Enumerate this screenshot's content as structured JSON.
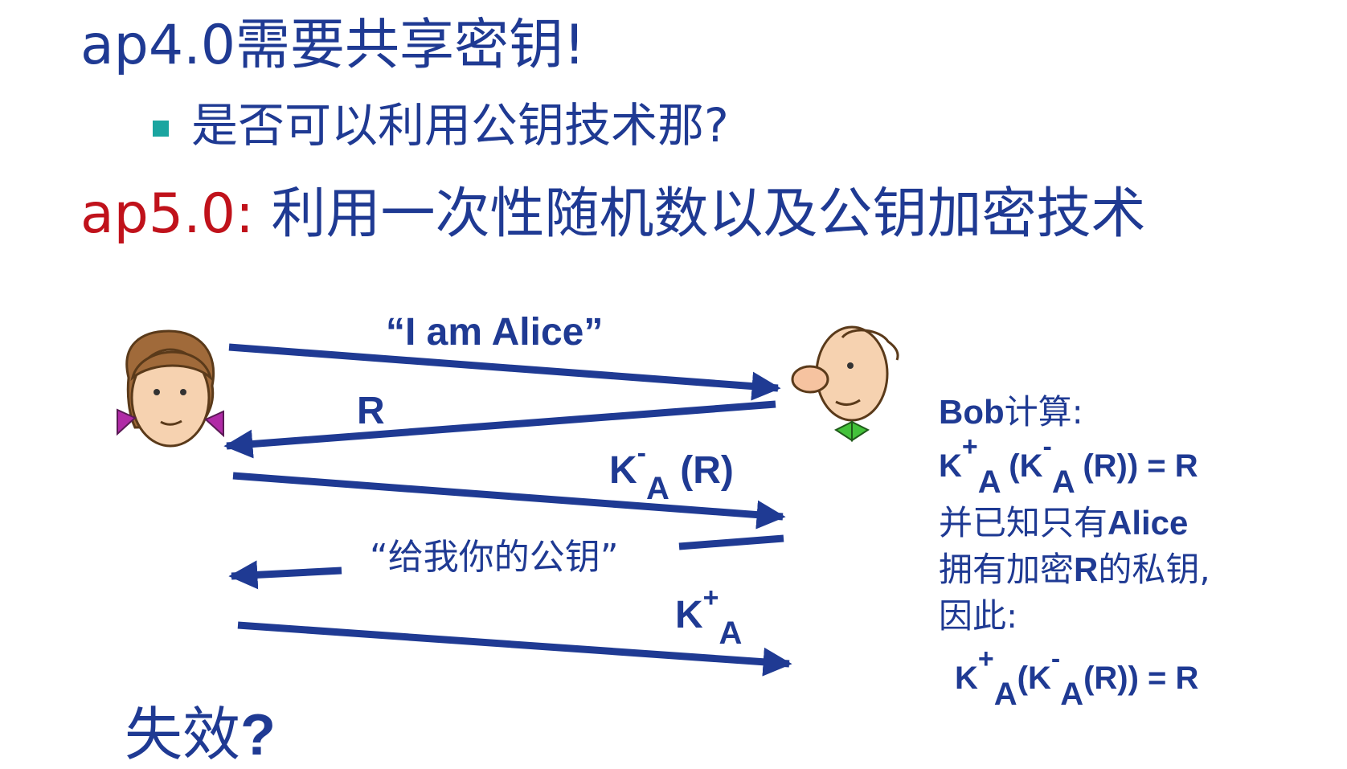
{
  "slide": {
    "title1": "ap4.0需要共享密钥!",
    "bullet_text": "是否可以利用公钥技术那?",
    "title2_prefix": "ap5.0:",
    "title2_text": " 利用一次性随机数以及公钥加密技术"
  },
  "messages": {
    "iam_alice": "“I am Alice”",
    "nonce": "R",
    "ka_minus_k": "K",
    "ka_minus_sup": "-",
    "ka_minus_sub": "A",
    "ka_minus_rest": " (R)",
    "ask_key": "“给我你的公钥”",
    "ka_plus_k": "K",
    "ka_plus_sup": "+",
    "ka_plus_sub": "A"
  },
  "bob": {
    "heading_bold": "Bob",
    "heading_rest": "计算:",
    "f1_k": "K",
    "f1_sup": "+",
    "f1_sub": "A",
    "f1_mid": " (K",
    "f1_sup2": "-",
    "f1_sub2": "A",
    "f1_end": " (R)) = R",
    "line1": "并已知只有",
    "line1_bold": "Alice",
    "line2a": "拥有加密",
    "line2_bold": "R",
    "line2b": "的私钥,",
    "line3": "因此:",
    "f2_k": "K",
    "f2_sup": "+",
    "f2_sub": "A",
    "f2_mid": "(K",
    "f2_sup2": "-",
    "f2_sub2": "A",
    "f2_end": "(R)) = R"
  },
  "footer": {
    "fail": "失效",
    "fail_q": "?"
  },
  "colors": {
    "title_blue": "#1f3a93",
    "title_red": "#c0121b",
    "bullet_teal": "#1aa5a0",
    "arrow_blue": "#1f3a93"
  }
}
